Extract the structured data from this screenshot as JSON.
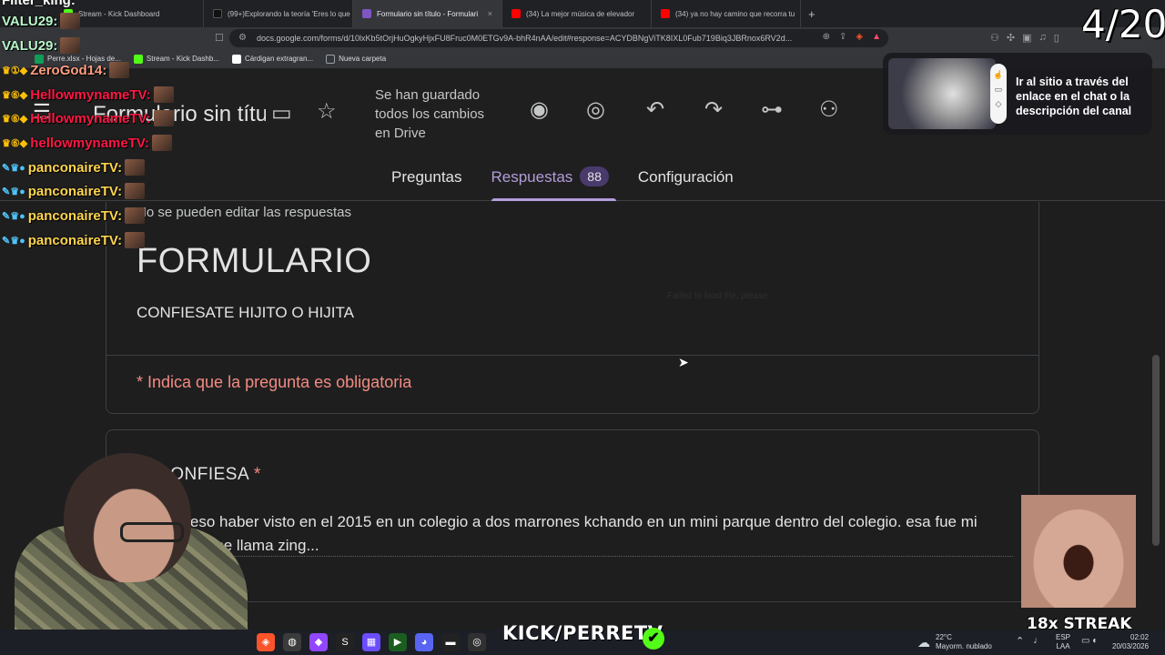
{
  "browser": {
    "tabs": [
      {
        "title": "Stream - Kick Dashboard",
        "color": "#53fc18",
        "active": false
      },
      {
        "title": "(99+)Explorando la teoría 'Eres lo que",
        "color": "#111111",
        "active": false
      },
      {
        "title": "Formulario sin título - Formulari",
        "color": "#7e57c2",
        "active": true
      },
      {
        "title": "(34) La mejor música de elevador",
        "color": "#ff0000",
        "active": false
      },
      {
        "title": "(34) ya no hay camino que recorra tu",
        "color": "#ff0000",
        "active": false
      }
    ],
    "tab_close": "×",
    "new_tab": "+",
    "url": "docs.google.com/forms/d/10lxKb5tOrjHuOgkyHjxFU8Fruc0M0ETGv9A-bhR4nAA/edit#response=ACYDBNgViTK8IXL0Fub719Biq3JBRnox6RV2d...",
    "bookmarks": [
      {
        "label": "Perre.xlsx - Hojas de...",
        "color": "#0f9d58"
      },
      {
        "label": "Stream - Kick Dashb...",
        "color": "#53fc18"
      },
      {
        "label": "Cárdigan extragran...",
        "color": "#ffffff"
      },
      {
        "label": "Nueva carpeta",
        "color": "#9aa0a6"
      }
    ]
  },
  "forms": {
    "title": "Formulario sin títu",
    "saved_status": "Se han guardado todos los cambios en Drive",
    "tabs": {
      "questions": "Preguntas",
      "responses": "Respuestas",
      "responses_count": "88",
      "settings": "Configuración"
    },
    "note": "No se pueden editar las respuestas",
    "header_title": "FORMULARIO",
    "header_subtitle": "CONFIESATE HIJITO O HIJITA",
    "failed_text": "Failed to load file, please",
    "required_note": "* Indica que la pregunta es obligatoria",
    "question": {
      "label": "CONFIESA",
      "required_mark": "*",
      "answer": "confieso haber visto en el 2015 en un colegio a dos marrones kchando en un mini parque dentro del colegio. esa fue mi amiga y se llama zing..."
    },
    "help": "?"
  },
  "overlay": {
    "chat": [
      {
        "user": "Filter_king:",
        "cls": "u-filter",
        "icons": ""
      },
      {
        "user": "VALU29:",
        "cls": "u-val",
        "icons": ""
      },
      {
        "user": "VALU29:",
        "cls": "u-val",
        "icons": ""
      },
      {
        "user": "ZeroGod14:",
        "cls": "u-zero",
        "icons": "♛①◆"
      },
      {
        "user": "HellowmynameTV:",
        "cls": "u-hello",
        "icons": "♛⑥◆"
      },
      {
        "user": "HellowmynameTV:",
        "cls": "u-hello",
        "icons": "♛⑥◆"
      },
      {
        "user": "hellowmynameTV:",
        "cls": "u-hello",
        "icons": "♛⑥◆"
      },
      {
        "user": "panconaireTV:",
        "cls": "u-pan",
        "icons": "✎♛●"
      },
      {
        "user": "panconaireTV:",
        "cls": "u-pan",
        "icons": "✎♛●"
      },
      {
        "user": "panconaireTV:",
        "cls": "u-pan",
        "icons": "✎♛●"
      },
      {
        "user": "panconaireTV:",
        "cls": "u-pan",
        "icons": "✎♛●"
      }
    ],
    "counter": "4/20",
    "promo_text": "Ir al sitio a través del enlace en el chat o la descripción del canal",
    "streak": "18x STREAK",
    "kick_brand": "KICK/PERRETV",
    "check": "✔"
  },
  "taskbar": {
    "weather_temp": "22°C",
    "weather_desc": "Mayorm. nublado",
    "lang_top": "ESP",
    "lang_bottom": "LAA",
    "time": "02:02",
    "date": "20/03/2026"
  }
}
